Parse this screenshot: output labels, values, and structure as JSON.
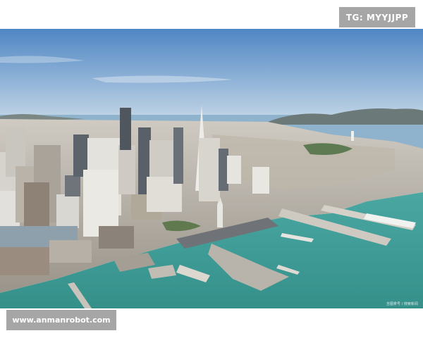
{
  "watermarks": {
    "top_label": "TG: MYYJJPP",
    "bottom_label": "www.anmanrobot.com"
  },
  "photo": {
    "subject": "aerial-city-waterfront",
    "credit_text": "吉图拿号 / 搜索新闻",
    "colors": {
      "sky_top": "#4f86c4",
      "sky_bottom": "#bcd3e6",
      "water": "#3f9b95",
      "bay": "#7fa7c4",
      "hills": "#6b7a78",
      "city_light": "#d7d3cc",
      "city_shadow": "#5f6770",
      "pier": "#b9b4ab"
    }
  }
}
